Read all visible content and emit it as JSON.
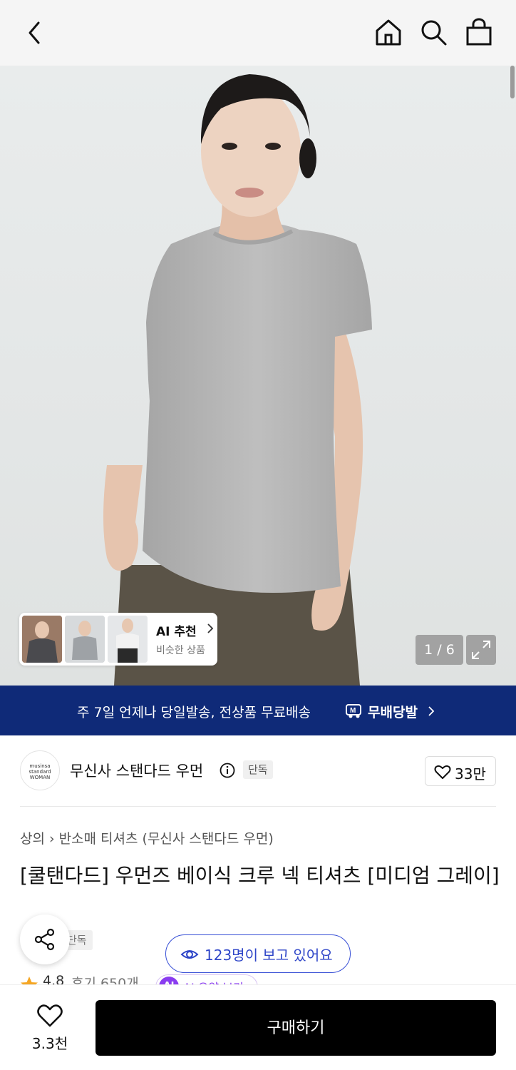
{
  "header": {
    "back_icon": "chevron-left-icon",
    "icons": [
      "home-icon",
      "search-icon",
      "shopping-bag-icon"
    ]
  },
  "gallery": {
    "counter": "1 / 6",
    "expand_icon": "expand-icon"
  },
  "ai_recommend": {
    "title": "AI 추천",
    "subtitle": "비슷한 상품"
  },
  "banner": {
    "text": "주 7일 언제나 당일발송, 전상품 무료배송",
    "badge": "무배당발",
    "bg_color": "#0f2a78"
  },
  "brand": {
    "logo_text": "musinsa standard WOMAN",
    "name": "무신사 스탠다드 우먼",
    "tag": "단독",
    "likes": "33만"
  },
  "breadcrumb": {
    "category": "상의",
    "subcategory": "반소매 티셔츠 (무신사 스탠다드 우먼)"
  },
  "product": {
    "title": "[쿨탠다드] 우먼즈 베이식 크루 넥 티셔츠 [미디엄 그레이]",
    "exclusive_tag": "단독",
    "viewers": "123명이 보고 있어요",
    "rating": "4.8",
    "reviews": "후기 650개",
    "ai_summary": "AI 요약 보기",
    "ai_badge": "AI"
  },
  "bottom_bar": {
    "wish_count": "3.3천",
    "buy_label": "구매하기"
  },
  "colors": {
    "accent": "#3850d6",
    "ai_purple": "#8a3cf0",
    "star": "#f5a623"
  }
}
